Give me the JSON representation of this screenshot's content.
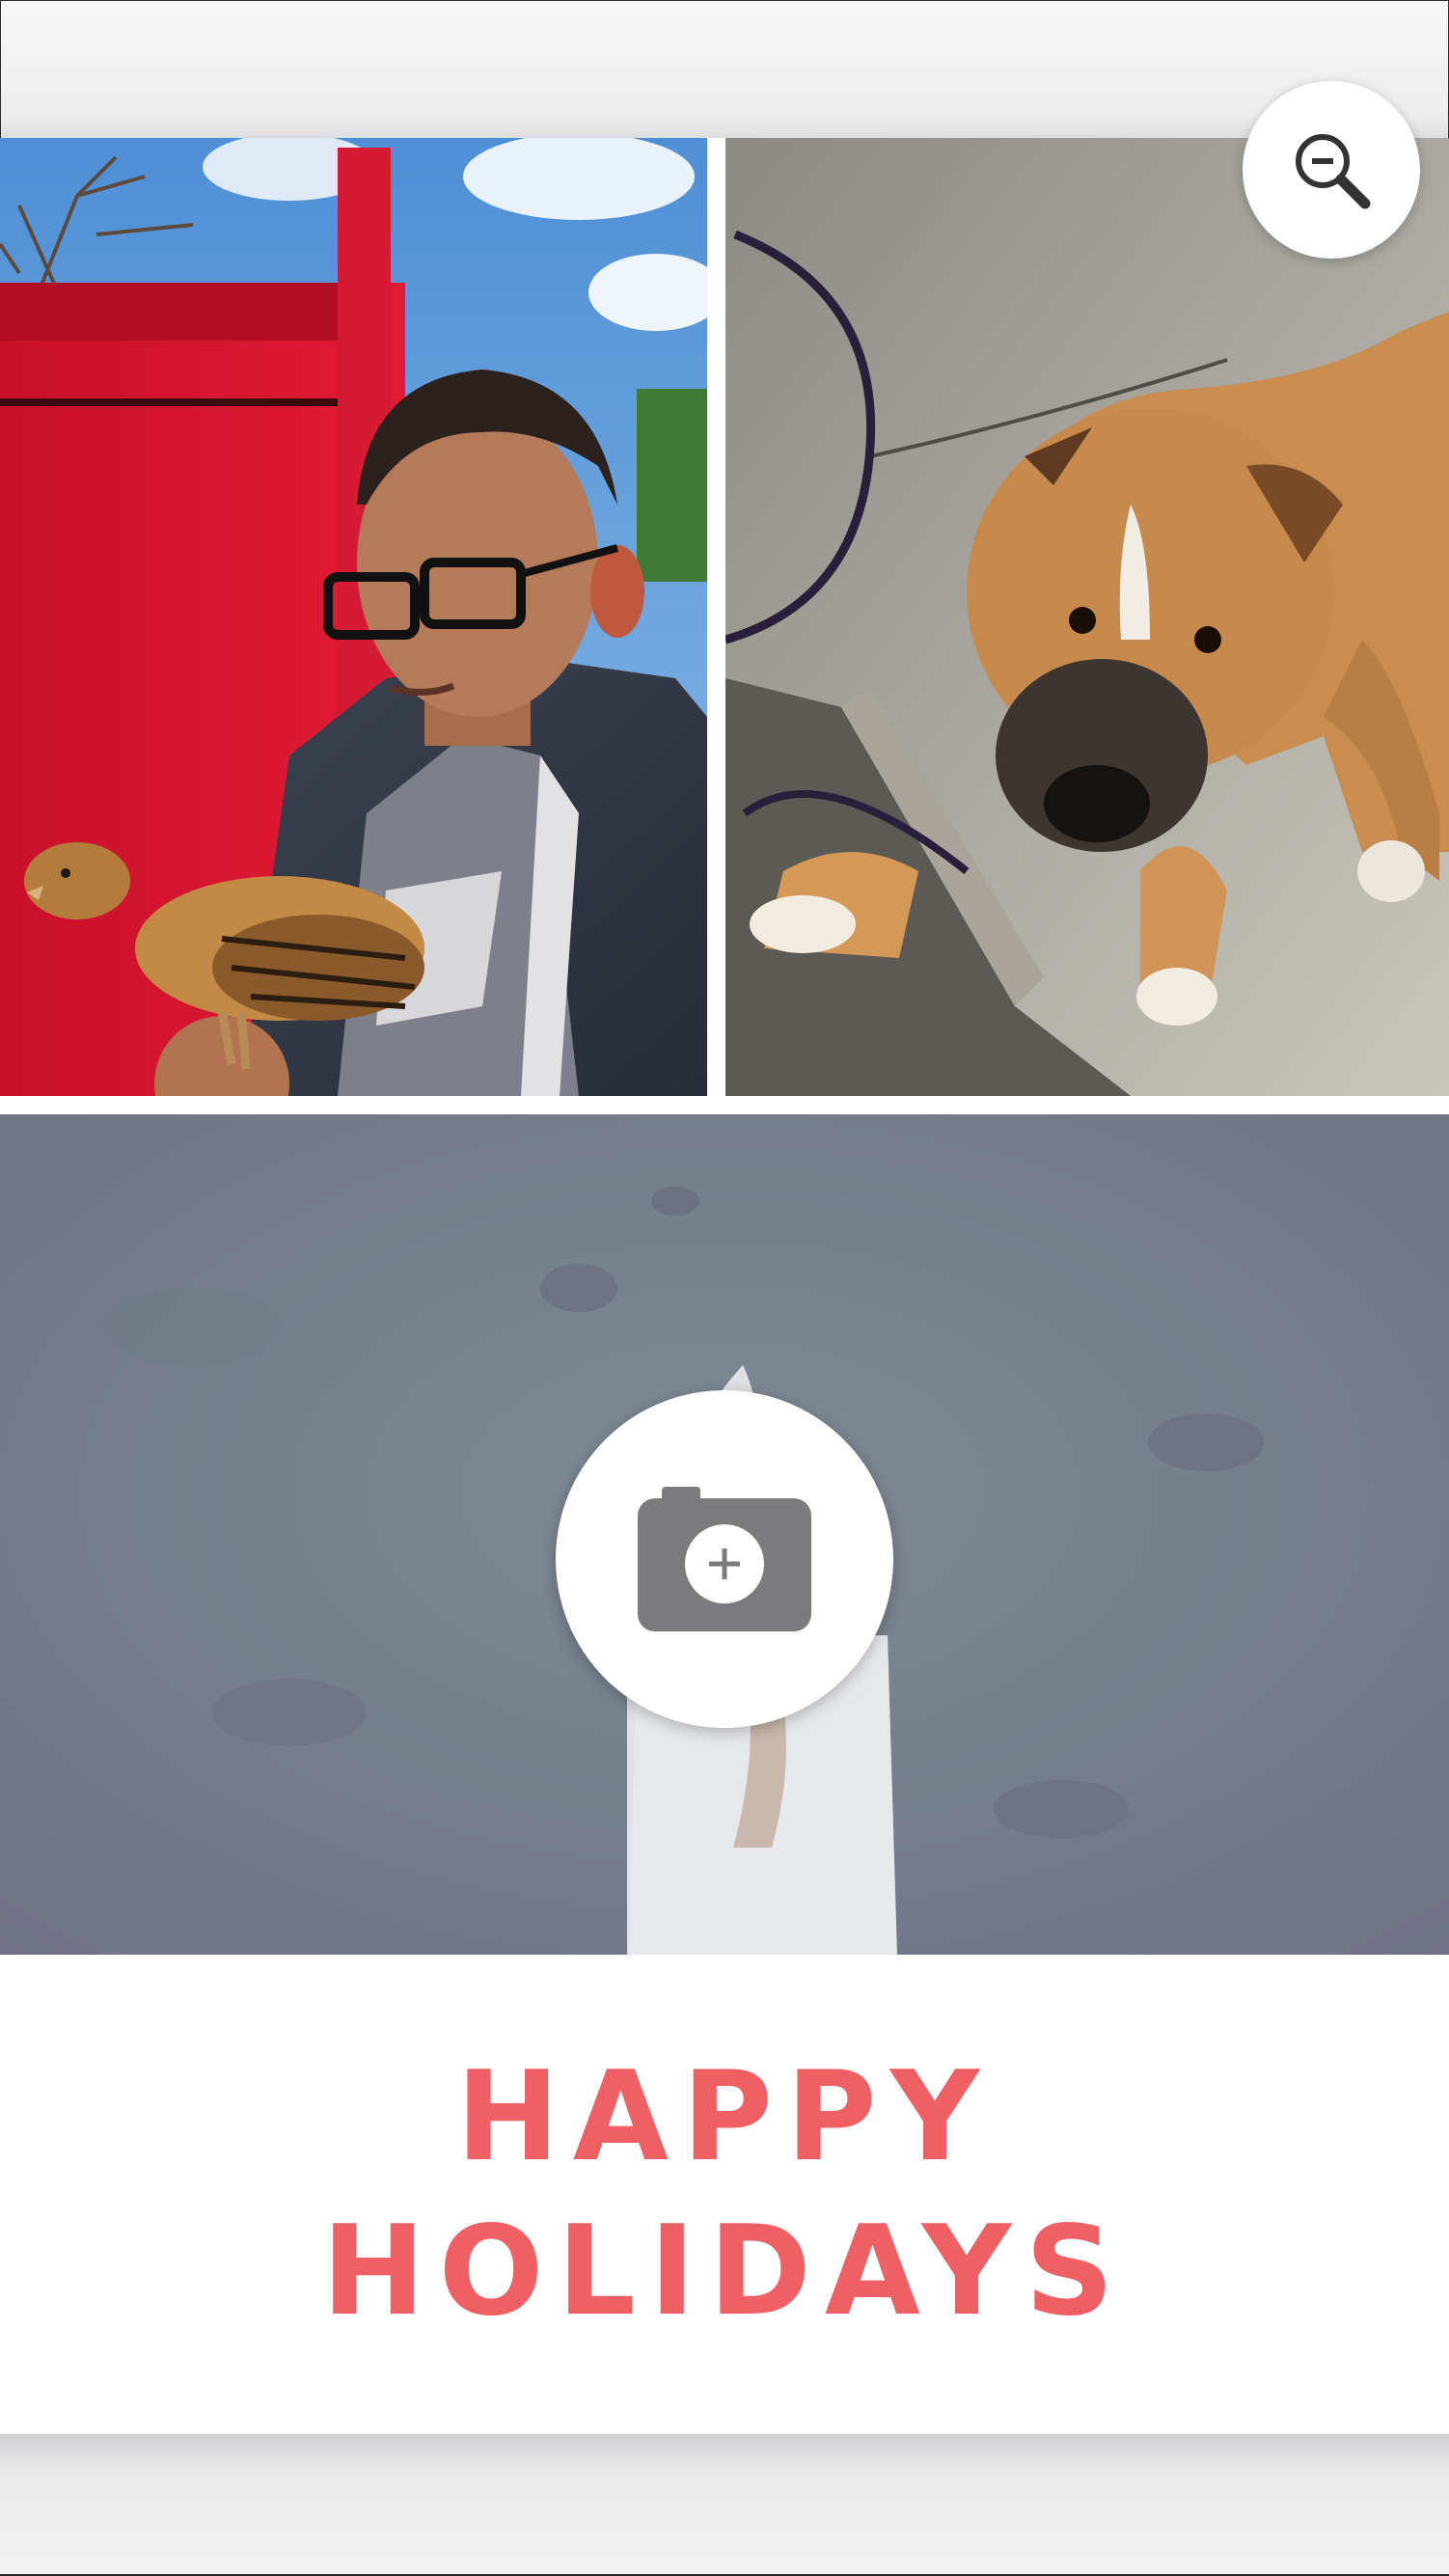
{
  "card": {
    "caption_line1": "HAPPY",
    "caption_line2": "HOLIDAYS",
    "caption_color": "#ef5f63"
  },
  "photos": [
    {
      "name": "photo-man-with-chicken"
    },
    {
      "name": "photo-dog"
    },
    {
      "name": "photo-aerial-placeholder"
    }
  ],
  "controls": {
    "zoom_icon": "zoom-out-icon",
    "add_photo_icon": "camera-add-icon"
  }
}
